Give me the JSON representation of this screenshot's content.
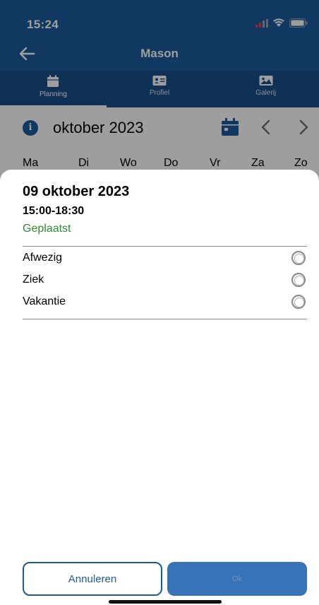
{
  "status_bar": {
    "time": "15:24"
  },
  "app_bar": {
    "title": "Mason"
  },
  "tabs": [
    {
      "label": "Planning",
      "icon": "calendar-icon",
      "active": true
    },
    {
      "label": "Profiel",
      "icon": "id-card-icon",
      "active": false
    },
    {
      "label": "Galerij",
      "icon": "image-icon",
      "active": false
    }
  ],
  "calendar": {
    "month": "oktober 2023",
    "weekdays": [
      "Ma",
      "Di",
      "Wo",
      "Do",
      "Vr",
      "Za",
      "Zo"
    ]
  },
  "sheet": {
    "date": "09 oktober 2023",
    "time": "15:00-18:30",
    "status": "Geplaatst",
    "options": [
      "Afwezig",
      "Ziek",
      "Vakantie"
    ],
    "cancel_label": "Annuleren",
    "ok_label": "Ok"
  },
  "colors": {
    "primary": "#1b5a9c",
    "status_green": "#2e8b2e"
  }
}
